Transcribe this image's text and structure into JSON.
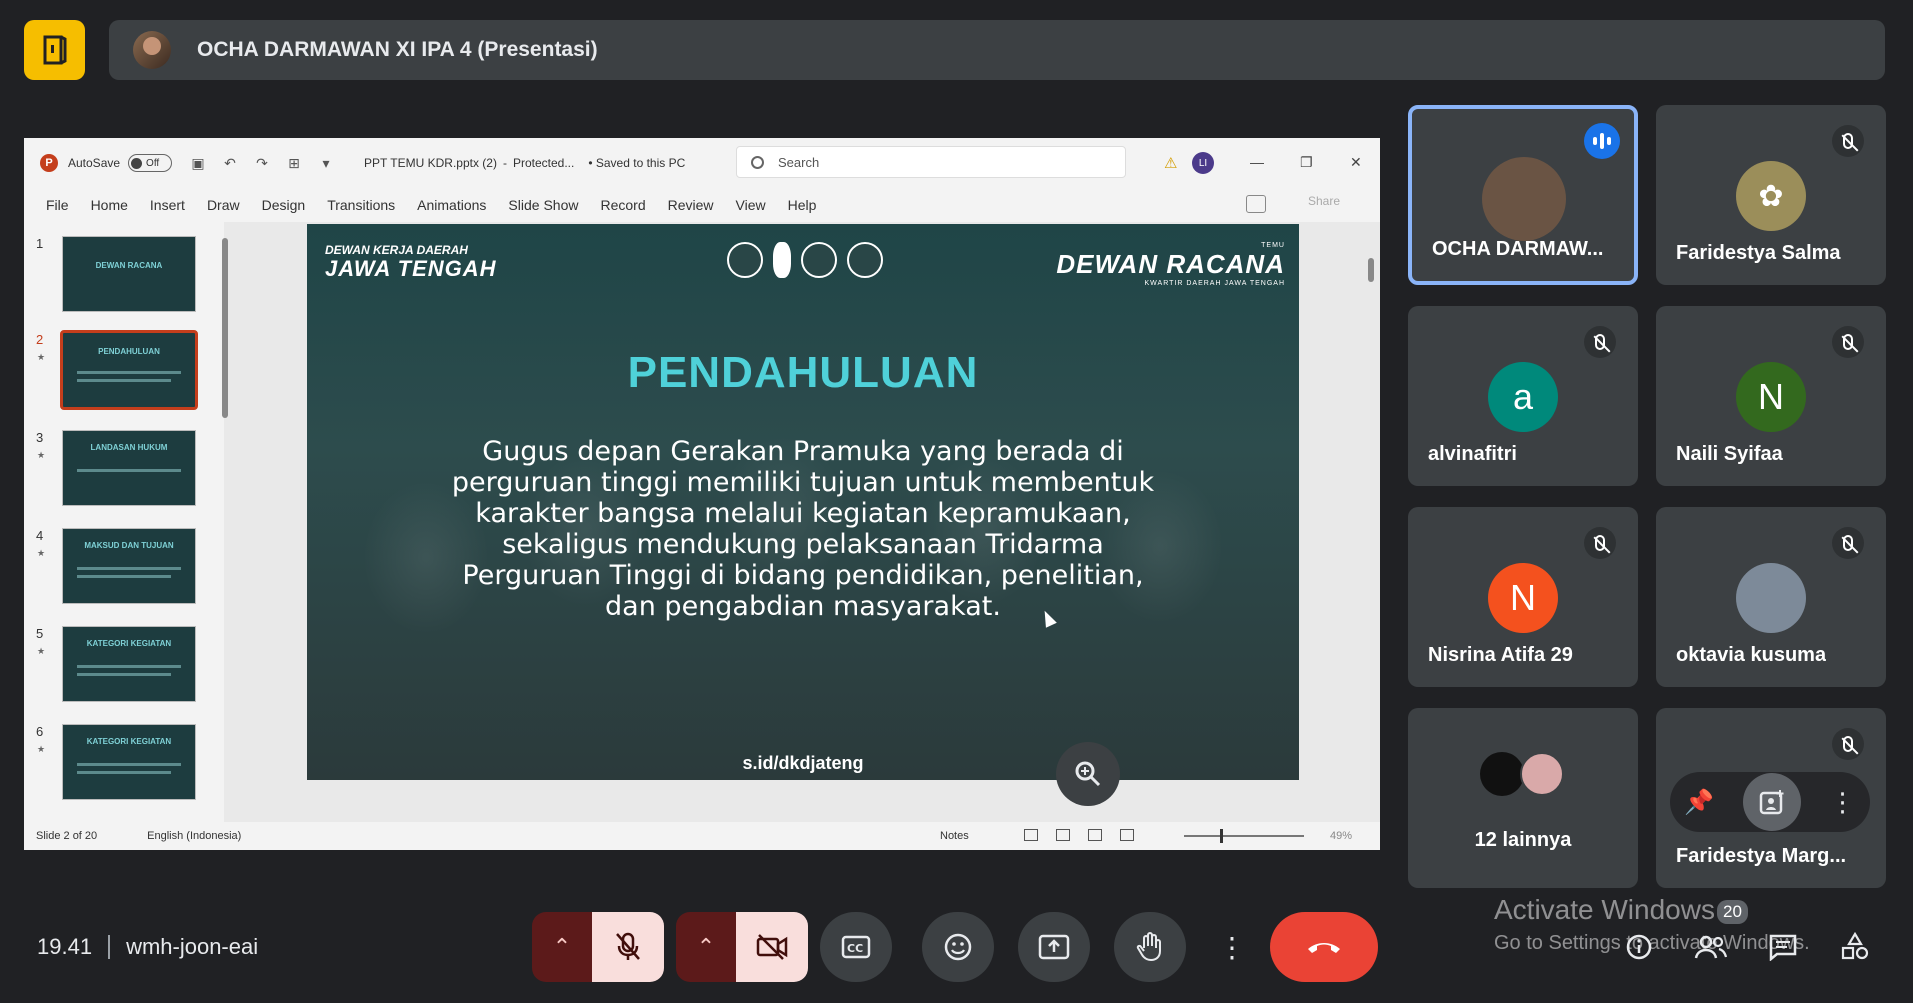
{
  "meet": {
    "presenter_label": "OCHA DARMAWAN XI IPA 4 (Presentasi)",
    "time": "19.41",
    "meeting_code": "wmh-joon-eai",
    "participant_count": "20",
    "activate_title": "Activate Windows",
    "activate_subtitle": "Go to Settings to activate Windows."
  },
  "ppt": {
    "autosave_label": "AutoSave",
    "autosave_state": "Off",
    "file_name": "PPT TEMU KDR.pptx (2)",
    "protected": "Protected...",
    "saved_status": "• Saved to this PC",
    "search_placeholder": "Search",
    "user_initials": "LI",
    "share": "Share",
    "menu": [
      "File",
      "Home",
      "Insert",
      "Draw",
      "Design",
      "Transitions",
      "Animations",
      "Slide Show",
      "Record",
      "Review",
      "View",
      "Help"
    ],
    "thumbs": [
      {
        "num": "1",
        "title": "DEWAN RACANA"
      },
      {
        "num": "2",
        "title": "PENDAHULUAN"
      },
      {
        "num": "3",
        "title": "LANDASAN HUKUM"
      },
      {
        "num": "4",
        "title": "MAKSUD DAN TUJUAN"
      },
      {
        "num": "5",
        "title": "KATEGORI KEGIATAN"
      },
      {
        "num": "6",
        "title": "KATEGORI KEGIATAN"
      }
    ],
    "status_slide": "Slide 2 of 20",
    "status_lang": "English (Indonesia)",
    "notes": "Notes",
    "zoom": "49%"
  },
  "slide": {
    "org_left_top": "DEWAN KERJA DAERAH",
    "org_left_big": "JAWA TENGAH",
    "org_right_top": "TEMU",
    "org_right_big": "DEWAN RACANA",
    "org_right_small": "KWARTIR DAERAH JAWA TENGAH",
    "heading": "PENDAHULUAN",
    "body": "Gugus depan Gerakan Pramuka yang berada di perguruan tinggi memiliki tujuan untuk membentuk karakter bangsa melalui kegiatan kepramukaan, sekaligus mendukung pelaksanaan Tridarma Perguruan Tinggi di bidang pendidikan, penelitian, dan pengabdian masyarakat.",
    "url": "s.id/dkdjateng"
  },
  "participants": [
    {
      "name": "OCHA DARMAW...",
      "initial": "",
      "color": "#6a5444"
    },
    {
      "name": "Faridestya Salma",
      "initial": "",
      "color": "#9b8e5a"
    },
    {
      "name": "alvinafitri",
      "initial": "a",
      "color": "#00897b"
    },
    {
      "name": "Naili Syifaa",
      "initial": "N",
      "color": "#33691e"
    },
    {
      "name": "Nisrina Atifa 29",
      "initial": "N",
      "color": "#f4511e"
    },
    {
      "name": "oktavia kusuma",
      "initial": "",
      "color": "#7d8a99"
    },
    {
      "name": "12 lainnya",
      "initial": "",
      "color": "#111111"
    },
    {
      "name": "Faridestya Marg...",
      "initial": "",
      "color": "#5f6368"
    }
  ],
  "colors": {
    "accent_blue": "#8ab4f8",
    "end_call": "#ea4335",
    "logo_yellow": "#f6be00",
    "slide_heading": "#4fd1d9"
  }
}
